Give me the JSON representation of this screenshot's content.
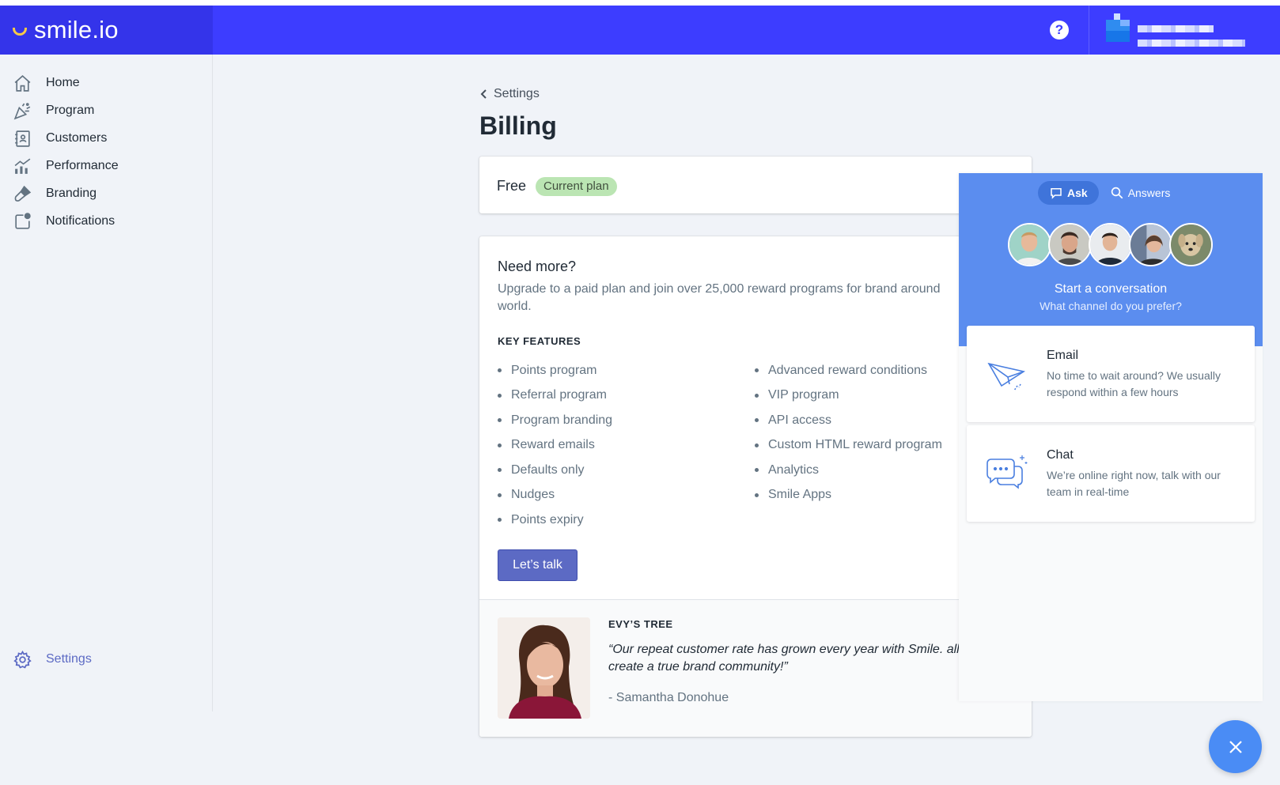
{
  "brand": {
    "name": "smile.io"
  },
  "header": {
    "help_icon": "question-circle-icon",
    "help_glyph": "?"
  },
  "sidebar": {
    "items": [
      {
        "label": "Home",
        "icon": "home-icon"
      },
      {
        "label": "Program",
        "icon": "party-popper-icon"
      },
      {
        "label": "Customers",
        "icon": "contact-book-icon"
      },
      {
        "label": "Performance",
        "icon": "chart-icon"
      },
      {
        "label": "Branding",
        "icon": "paintbrush-icon"
      },
      {
        "label": "Notifications",
        "icon": "notification-icon"
      }
    ],
    "settings": {
      "label": "Settings",
      "icon": "gear-icon"
    }
  },
  "page": {
    "breadcrumb": "Settings",
    "title": "Billing"
  },
  "plan": {
    "name": "Free",
    "badge": "Current plan",
    "badge_color": "#bbe5b3"
  },
  "upgrade": {
    "title": "Need more?",
    "description": "Upgrade to a paid plan and join over 25,000 reward programs for brand around\nworld.",
    "features_heading": "KEY FEATURES",
    "features_left": [
      "Points program",
      "Referral program",
      "Program branding",
      "Reward emails",
      "Defaults only",
      "Nudges",
      "Points expiry"
    ],
    "features_right": [
      "Advanced reward conditions",
      "VIP program",
      "API access",
      "Custom HTML reward program",
      "Analytics",
      "Smile Apps"
    ],
    "cta": "Let’s talk"
  },
  "testimonial": {
    "company": "EVY’S TREE",
    "quote": "“Our repeat customer rate has grown every year with Smile. allowed us to create a true brand community!”",
    "author": "- Samantha Donohue"
  },
  "help_widget": {
    "tabs": [
      {
        "label": "Ask",
        "icon": "chat-bubble-icon",
        "active": true
      },
      {
        "label": "Answers",
        "icon": "search-icon",
        "active": false
      }
    ],
    "title": "Start a conversation",
    "subtitle": "What channel do you prefer?",
    "channels": [
      {
        "title": "Email",
        "description": "No time to wait around? We usually respond within a few hours",
        "icon": "paper-plane-icon"
      },
      {
        "title": "Chat",
        "description": "We’re online right now, talk with our team in real-time",
        "icon": "chat-bubbles-icon"
      }
    ],
    "close_icon": "close-icon"
  },
  "colors": {
    "topbar": "#3d3dff",
    "brand_bg": "#3434ea",
    "accent": "#5c6ac4",
    "widget": "#5b8def"
  }
}
